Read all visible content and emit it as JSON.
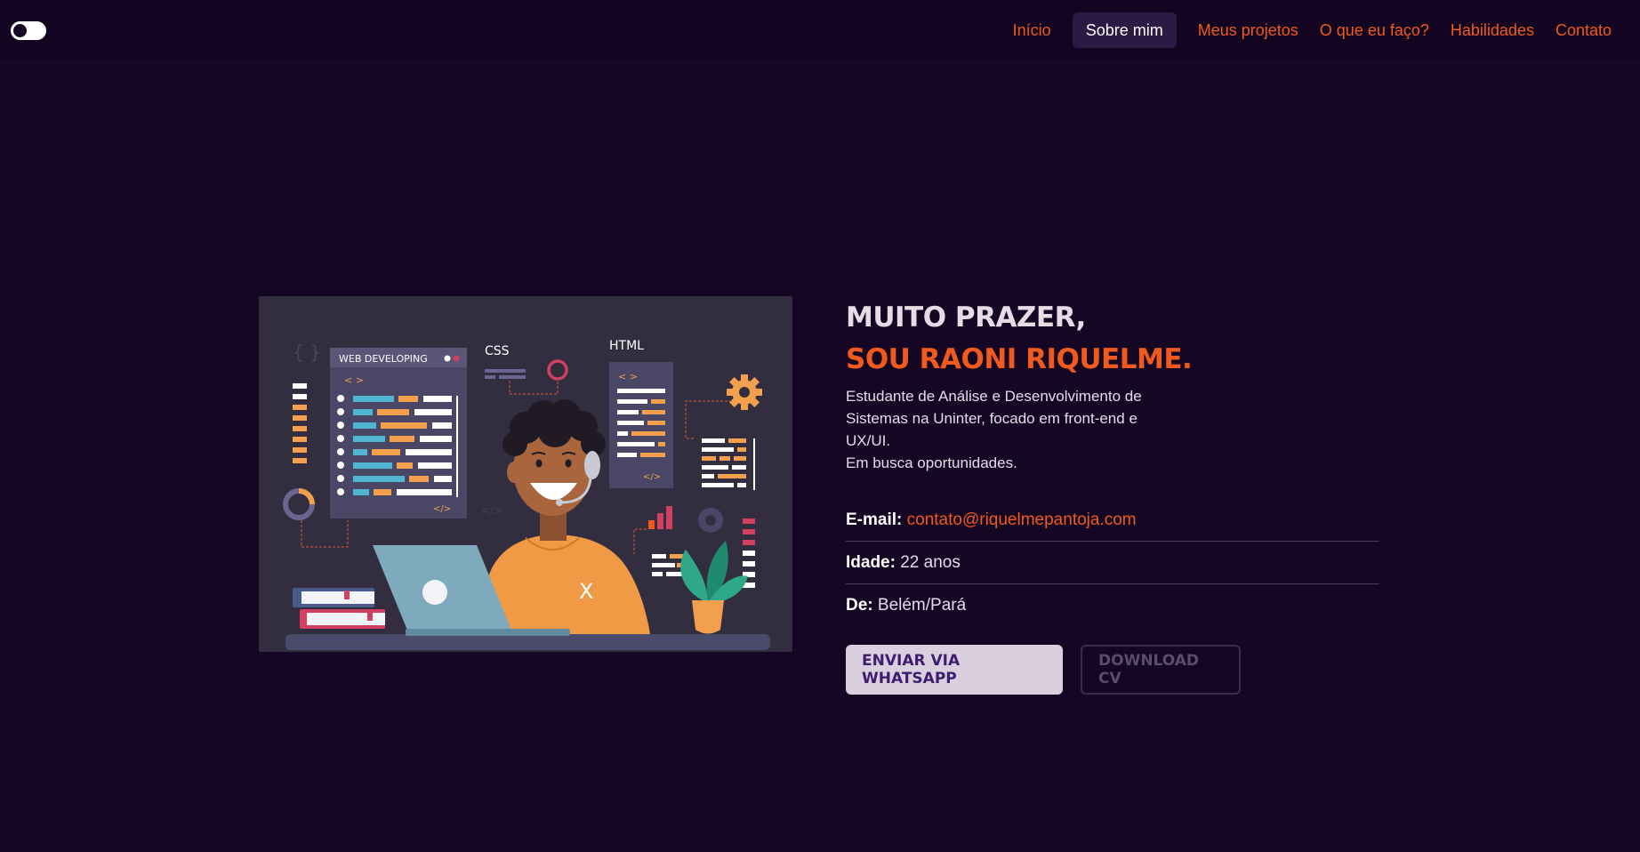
{
  "header": {
    "theme_toggle": "theme-toggle",
    "nav": [
      {
        "label": "Início",
        "active": false
      },
      {
        "label": "Sobre mim",
        "active": true
      },
      {
        "label": "Meus projetos",
        "active": false
      },
      {
        "label": "O que eu faço?",
        "active": false
      },
      {
        "label": "Habilidades",
        "active": false
      },
      {
        "label": "Contato",
        "active": false
      }
    ]
  },
  "illustration": {
    "panel_title": "WEB DEVELOPING",
    "css_label": "CSS",
    "html_label": "HTML",
    "tag_open": "< >",
    "tag_close": "</>",
    "braces": "{ }",
    "x_mark": "X"
  },
  "about": {
    "greeting": "MUITO PRAZER,",
    "name": "SOU RAONI RIQUELME.",
    "description_1": "Estudante de Análise e Desenvolvimento de Sistemas na Uninter, focado em front-end e UX/UI.",
    "description_2": "Em busca oportunidades.",
    "email_label": "E-mail:",
    "email_value": "contato@riquelmepantoja.com",
    "age_label": "Idade:",
    "age_value": "22 anos",
    "from_label": "De:",
    "from_value": "Belém/Pará"
  },
  "buttons": {
    "whatsapp": "ENVIAR VIA WHATSAPP",
    "download": "DOWNLOAD CV"
  },
  "colors": {
    "background": "#150623",
    "accent": "#f05a1f",
    "text": "#e6dbe8",
    "illustration_bg": "#322e40"
  }
}
